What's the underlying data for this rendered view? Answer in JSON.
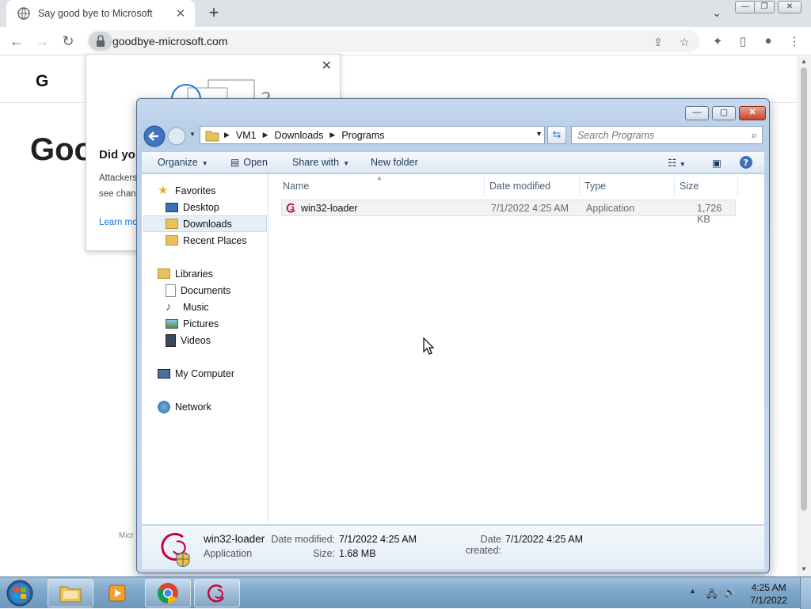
{
  "browser": {
    "tab_title": "Say good bye to Microsoft",
    "url": "goodbye-microsoft.com",
    "page": {
      "logo_letter": "G",
      "heading_fragment": "Goo",
      "footer_fragment": "Micr"
    },
    "popup": {
      "title_fragment": "Did yo",
      "body_line1": "Attackers",
      "body_line2": "see chan",
      "link_fragment": "Learn mo"
    }
  },
  "explorer": {
    "breadcrumb": [
      "VM1",
      "Downloads",
      "Programs"
    ],
    "search_placeholder": "Search Programs",
    "commands": {
      "organize": "Organize",
      "open": "Open",
      "share_with": "Share with",
      "new_folder": "New folder"
    },
    "nav": {
      "favorites": "Favorites",
      "desktop": "Desktop",
      "downloads": "Downloads",
      "recent_places": "Recent Places",
      "libraries": "Libraries",
      "documents": "Documents",
      "music": "Music",
      "pictures": "Pictures",
      "videos": "Videos",
      "my_computer": "My Computer",
      "network": "Network"
    },
    "columns": [
      "Name",
      "Date modified",
      "Type",
      "Size"
    ],
    "files": [
      {
        "name": "win32-loader",
        "date_modified": "7/1/2022 4:25 AM",
        "type": "Application",
        "size": "1,726 KB"
      }
    ],
    "details": {
      "name": "win32-loader",
      "type": "Application",
      "date_modified_label": "Date modified:",
      "date_modified": "7/1/2022 4:25 AM",
      "size_label": "Size:",
      "size": "1.68 MB",
      "date_created_label": "Date created:",
      "date_created": "7/1/2022 4:25 AM"
    }
  },
  "taskbar": {
    "time": "4:25 AM",
    "date": "7/1/2022"
  },
  "colors": {
    "chrome_tabstrip": "#dee1e6",
    "explorer_frame": "#b9cfe8",
    "taskbar": "#7ea6c9",
    "close_button": "#c7442b"
  }
}
